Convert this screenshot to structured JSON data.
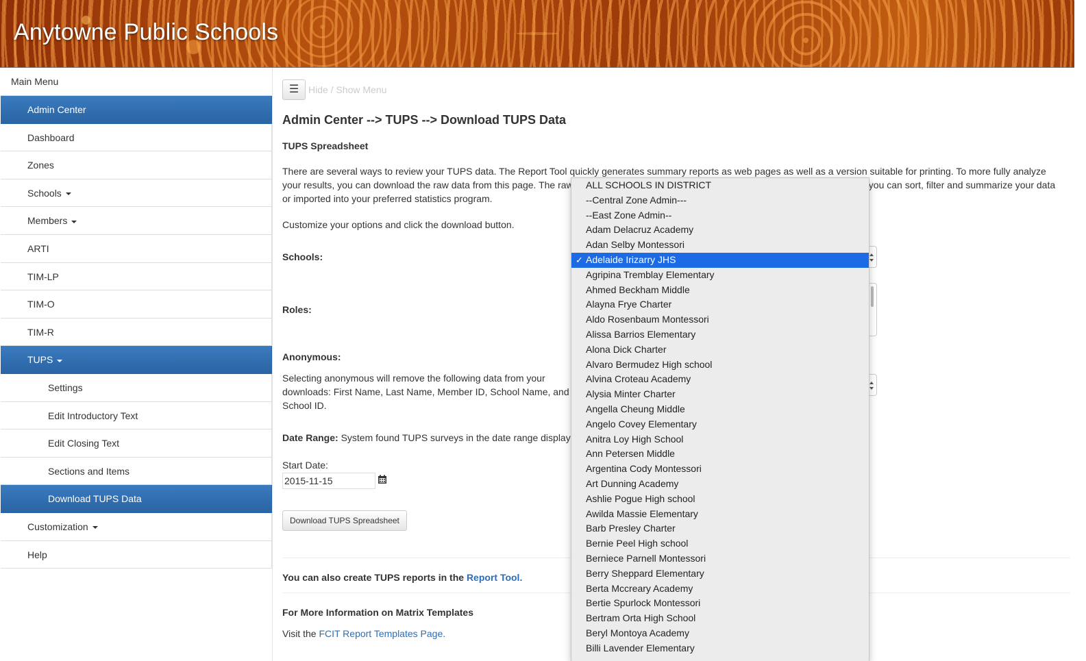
{
  "header": {
    "title": "Anytowne Public Schools"
  },
  "sidebar": {
    "menu_title": "Main Menu",
    "items": [
      {
        "label": "Admin Center",
        "active": true
      },
      {
        "label": "Dashboard"
      },
      {
        "label": "Zones"
      },
      {
        "label": "Schools"
      },
      {
        "label": "Members"
      },
      {
        "label": "ARTI"
      },
      {
        "label": "TIM-LP"
      },
      {
        "label": "TIM-O"
      },
      {
        "label": "TIM-R"
      },
      {
        "label": "TUPS"
      },
      {
        "label": "Settings"
      },
      {
        "label": "Edit Introductory Text"
      },
      {
        "label": "Edit Closing Text"
      },
      {
        "label": "Sections and Items"
      },
      {
        "label": "Download TUPS Data"
      },
      {
        "label": "Customization"
      },
      {
        "label": "Help"
      }
    ]
  },
  "main": {
    "toggle_label": "Hide / Show Menu",
    "breadcrumb": "Admin Center --> TUPS --> Download TUPS Data",
    "subheading": "TUPS Spreadsheet",
    "intro_para": "There are several ways to review your TUPS data. The Report Tool quickly generates summary reports as web pages as well as a version suitable for printing. To more fully analyze your results, you can download the raw data from this page. The raw data can be opened in a spreadsheet program such as Excel, where you can sort, filter and summarize your data or imported into your preferred statistics program.",
    "customize": "Customize your options and click the download button.",
    "schools_label": "Schools:",
    "roles_label": "Roles:",
    "anonymous_label": "Anonymous:",
    "anonymous_text": "Selecting anonymous will remove the following data from your downloads: First Name, Last Name, Member ID, School Name, and School ID.",
    "date_range_label": "Date Range:",
    "date_range_text": " System found TUPS surveys in the date range displayed below.",
    "start_date_label": "Start Date:",
    "start_date_value": "2015-11-15",
    "download_button": "Download TUPS Spreadsheet",
    "report_text": "You can also create TUPS reports in the ",
    "report_link": "Report Tool.",
    "more_info": "For More Information on Matrix Templates",
    "visit_text": "Visit the ",
    "visit_link": "FCIT Report Templates Page."
  },
  "schools_dropdown": {
    "selected": "Adelaide Irizarry JHS",
    "options": [
      "ALL SCHOOLS IN DISTRICT",
      "--Central Zone Admin---",
      "--East Zone Admin--",
      "Adam Delacruz Academy",
      "Adan Selby Montessori",
      "Adelaide Irizarry JHS",
      "Agripina Tremblay Elementary",
      "Ahmed Beckham Middle",
      "Alayna Frye Charter",
      "Aldo Rosenbaum Montessori",
      "Alissa Barrios Elementary",
      "Alona Dick Charter",
      "Alvaro Bermudez High school",
      "Alvina Croteau Academy",
      "Alysia Minter Charter",
      "Angella Cheung Middle",
      "Angelo Covey Elementary",
      "Anitra Loy High School",
      "Ann Petersen Middle",
      "Argentina Cody Montessori",
      "Art Dunning Academy",
      "Ashlie Pogue High school",
      "Awilda Massie Elementary",
      "Barb Presley Charter",
      "Bernie Peel High school",
      "Berniece Parnell Montessori",
      "Berry Sheppard Elementary",
      "Berta Mccreary Academy",
      "Bertie Spurlock Montessori",
      "Bertram Orta High School",
      "Beryl Montoya Academy",
      "Billi Lavender Elementary"
    ]
  }
}
